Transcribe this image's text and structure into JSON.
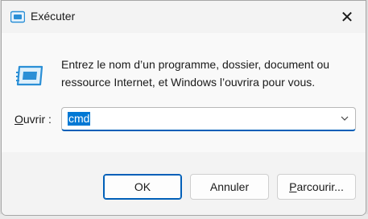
{
  "window": {
    "title": "Exécuter",
    "close_glyph": "✕"
  },
  "icons": {
    "title": "run-icon",
    "main": "run-icon",
    "close": "close-icon",
    "dropdown": "chevron-down-icon"
  },
  "description": "Entrez le nom d’un programme, dossier, document ou ressource Internet, et Windows l’ouvrira pour vous.",
  "open_field": {
    "label_first": "O",
    "label_rest": "uvrir :",
    "value": "cmd"
  },
  "buttons": {
    "ok": "OK",
    "cancel": "Annuler",
    "browse_first": "P",
    "browse_rest": "arcourir..."
  },
  "colors": {
    "accent": "#005fb8",
    "selection": "#0078d4",
    "icon_blue": "#2b8fd6"
  }
}
